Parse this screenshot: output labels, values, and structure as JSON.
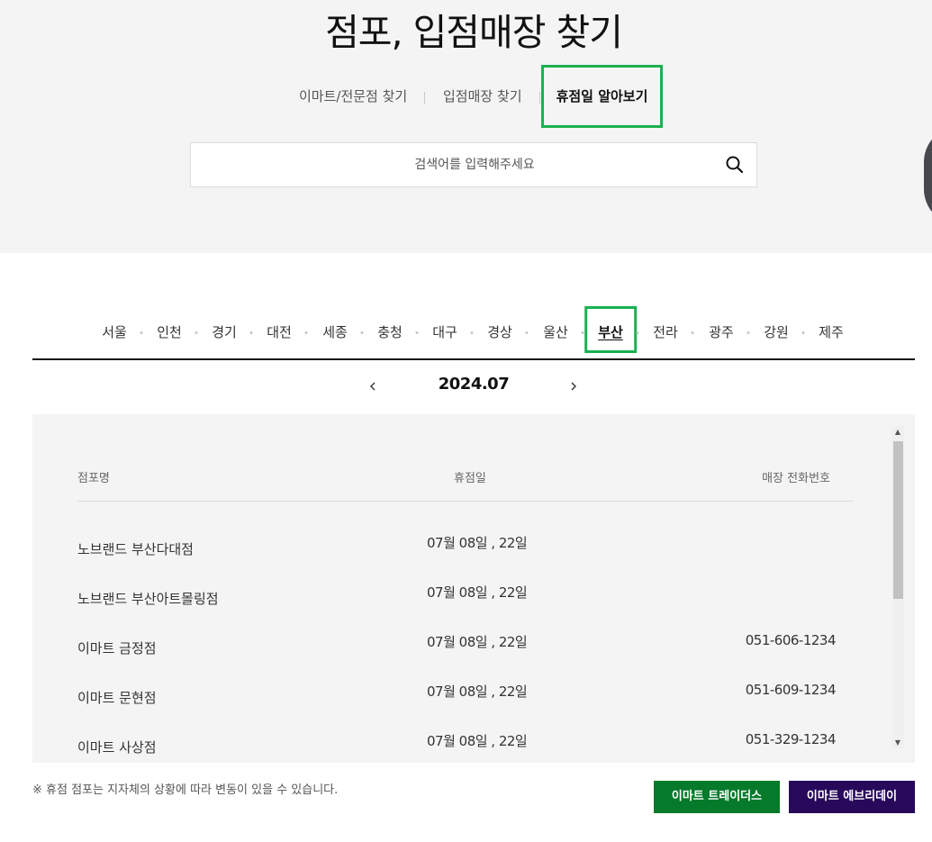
{
  "page_title": "점포, 입점매장 찾기",
  "tabs": [
    {
      "label": "이마트/전문점 찾기",
      "active": false
    },
    {
      "label": "입점매장 찾기",
      "active": false
    },
    {
      "label": "휴점일 알아보기",
      "active": true
    }
  ],
  "search": {
    "placeholder": "검색어를 입력해주세요",
    "value": "",
    "icon": "search-icon"
  },
  "regions": {
    "items": [
      "서울",
      "인천",
      "경기",
      "대전",
      "세종",
      "충청",
      "대구",
      "경상",
      "울산",
      "부산",
      "전라",
      "광주",
      "강원",
      "제주"
    ],
    "active": "부산"
  },
  "month": {
    "label": "2024.07",
    "prev_icon": "chevron-left-icon",
    "next_icon": "chevron-right-icon"
  },
  "table": {
    "headers": [
      "점포명",
      "휴점일",
      "매장 전화번호"
    ],
    "rows": [
      {
        "name": "노브랜드 부산다대점",
        "closed_days": "07월 08일 , 22일",
        "phone": ""
      },
      {
        "name": "노브랜드 부산아트몰링점",
        "closed_days": "07월 08일 , 22일",
        "phone": ""
      },
      {
        "name": "이마트 금정점",
        "closed_days": "07월 08일 , 22일",
        "phone": "051-606-1234"
      },
      {
        "name": "이마트 문현점",
        "closed_days": "07월 08일 , 22일",
        "phone": "051-609-1234"
      },
      {
        "name": "이마트 사상점",
        "closed_days": "07월 08일 , 22일",
        "phone": "051-329-1234"
      }
    ]
  },
  "notice": "※ 휴점 점포는 지자체의 상황에 따라 변동이 있을 수 있습니다.",
  "buttons": [
    {
      "label": "이마트 트레이더스",
      "color": "#047a2a"
    },
    {
      "label": "이마트 에브리데이",
      "color": "#28085a"
    }
  ],
  "colors": {
    "highlight_border": "#1ab14f",
    "top_background": "#f4f4f4"
  }
}
